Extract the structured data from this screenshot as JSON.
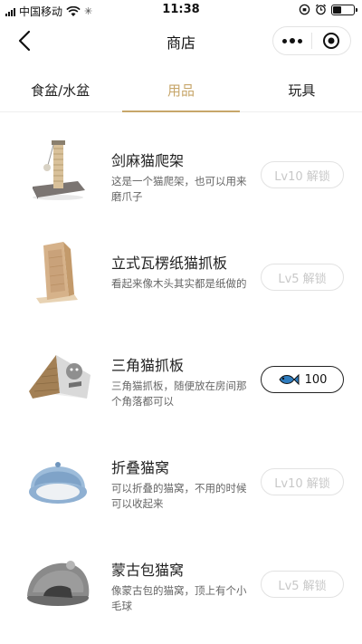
{
  "status_bar": {
    "carrier": "中国移动",
    "time": "11:38"
  },
  "nav": {
    "title": "商店"
  },
  "tabs": [
    {
      "label": "食盆/水盆",
      "active": false
    },
    {
      "label": "用品",
      "active": true
    },
    {
      "label": "玩具",
      "active": false
    }
  ],
  "items": [
    {
      "name": "剑麻猫爬架",
      "desc": "这是一个猫爬架，也可以用来磨爪子",
      "button": "Lv10 解锁",
      "button_type": "locked",
      "image": "cat-tree-image"
    },
    {
      "name": "立式瓦楞纸猫抓板",
      "desc": "看起来像木头其实都是纸做的",
      "button": "Lv5 解锁",
      "button_type": "locked",
      "image": "cardboard-scratcher-image"
    },
    {
      "name": "三角猫抓板",
      "desc": "三角猫抓板，随便放在房间那个角落都可以",
      "button": "100",
      "button_type": "buy",
      "button_icon": "fish-icon",
      "image": "triangle-scratcher-image"
    },
    {
      "name": "折叠猫窝",
      "desc": "可以折叠的猫窝，不用的时候可以收起来",
      "button": "Lv10 解锁",
      "button_type": "locked",
      "image": "folding-cat-bed-image"
    },
    {
      "name": "蒙古包猫窝",
      "desc": "像蒙古包的猫窝，顶上有个小毛球",
      "button": "Lv5 解锁",
      "button_type": "locked",
      "image": "yurt-cat-bed-image"
    }
  ],
  "colors": {
    "accent": "#c7a66a",
    "locked_text": "#c8c8c8",
    "desc_text": "#666666"
  }
}
